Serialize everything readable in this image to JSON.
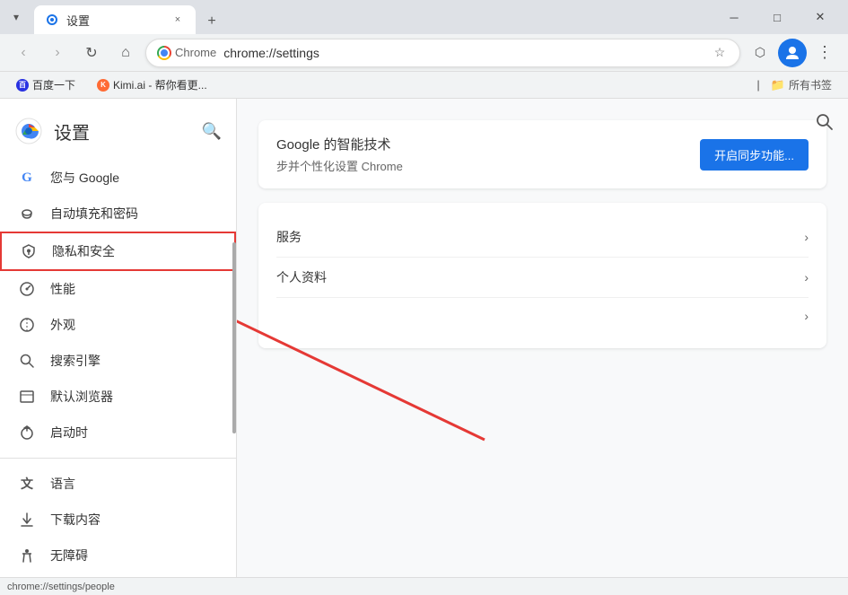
{
  "browser": {
    "title": "设置",
    "tab_favicon": "settings",
    "tab_close": "×",
    "new_tab": "+",
    "url": "chrome://settings",
    "chrome_label": "Chrome",
    "win_minimize": "─",
    "win_maximize": "□",
    "win_close": "✕"
  },
  "nav": {
    "back_disabled": true,
    "forward_disabled": true
  },
  "bookmarks": {
    "item1": "百度一下",
    "item2": "Kimi.ai - 帮你看更...",
    "bookmarks_folder": "所有书签"
  },
  "settings": {
    "title": "设置",
    "search_icon": "🔍",
    "sidebar_items": [
      {
        "id": "google",
        "label": "您与 Google",
        "icon": "G"
      },
      {
        "id": "autofill",
        "label": "自动填充和密码",
        "icon": "⚙"
      },
      {
        "id": "privacy",
        "label": "隐私和安全",
        "icon": "🛡",
        "highlighted": true
      },
      {
        "id": "performance",
        "label": "性能",
        "icon": "📊"
      },
      {
        "id": "appearance",
        "label": "外观",
        "icon": "🌐"
      },
      {
        "id": "search",
        "label": "搜索引擎",
        "icon": "🔍"
      },
      {
        "id": "browser",
        "label": "默认浏览器",
        "icon": "⬜"
      },
      {
        "id": "startup",
        "label": "启动时",
        "icon": "⏻"
      }
    ],
    "sidebar_items2": [
      {
        "id": "language",
        "label": "语言",
        "icon": "A"
      },
      {
        "id": "downloads",
        "label": "下载内容",
        "icon": "⬇"
      },
      {
        "id": "accessibility",
        "label": "无障碍",
        "icon": "♿"
      }
    ],
    "sync_title": "Google 的智能技术",
    "sync_desc": "步并个性化设置 Chrome",
    "sync_btn": "开启同步功能...",
    "section1_label": "服务",
    "section2_label": "个人资料",
    "section3_label": ""
  },
  "status_bar": {
    "url": "chrome://settings/people"
  }
}
